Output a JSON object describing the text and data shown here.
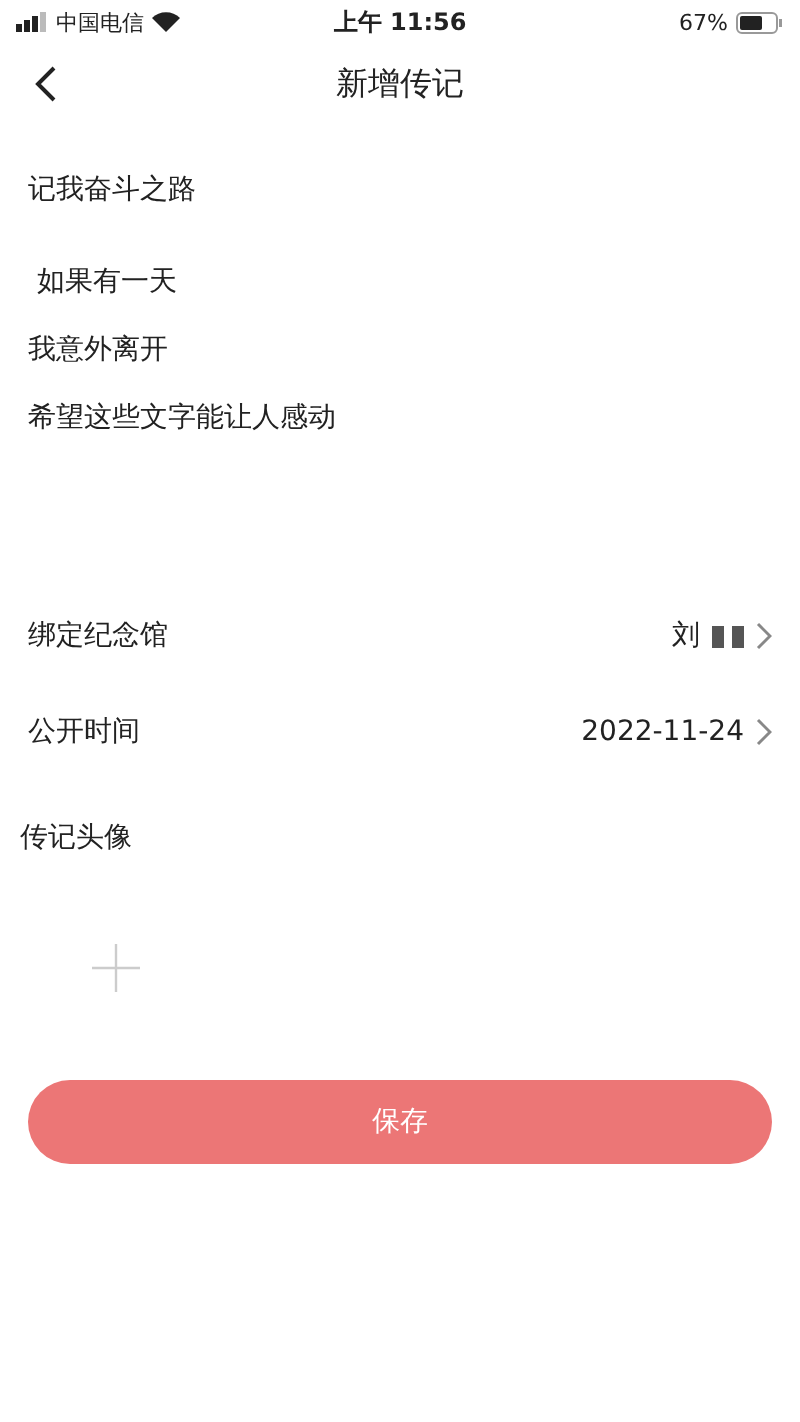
{
  "status_bar": {
    "carrier": "中国电信",
    "time": "上午 11:56",
    "battery": "67%"
  },
  "nav": {
    "title": "新增传记"
  },
  "biography": {
    "title": "记我奋斗之路",
    "lines": [
      " 如果有一天",
      "我意外离开",
      "希望这些文字能让人感动"
    ]
  },
  "rows": [
    {
      "label": "绑定纪念馆",
      "value": "刘",
      "redacted": true
    },
    {
      "label": "公开时间",
      "value": "2022-11-24",
      "redacted": false
    }
  ],
  "avatar": {
    "label": "传记头像"
  },
  "save_button": {
    "label": "保存"
  }
}
